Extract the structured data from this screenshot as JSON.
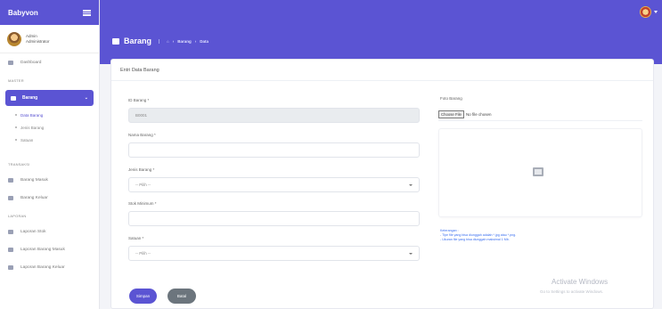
{
  "app": {
    "name": "Babyvon"
  },
  "user": {
    "name": "Admin",
    "role": "Administrator"
  },
  "sidebar": {
    "dashboard": "Dashboard",
    "master_heading": "MASTER",
    "master_item": "Barang",
    "sub_items": [
      "Data Barang",
      "Jenis Barang",
      "Satuan"
    ],
    "transaksi_heading": "TRANSAKSI",
    "transaksi_items": [
      "Barang Masuk",
      "Barang Keluar"
    ],
    "laporan_heading": "LAPORAN",
    "laporan_items": [
      "Laporan Stok",
      "Laporan Barang Masuk",
      "Laporan Barang Keluar"
    ]
  },
  "header": {
    "title": "Barang",
    "breadcrumb": [
      "Barang",
      "Data"
    ]
  },
  "form": {
    "title": "Entri Data Barang",
    "id_label": "ID Barang *",
    "id_value": "B0001",
    "name_label": "Nama Barang *",
    "jenis_label": "Jenis Barang *",
    "jenis_selected": "-- Pilih --",
    "stok_label": "Stok Minimum *",
    "satuan_label": "Satuan *",
    "satuan_selected": "-- Pilih --",
    "photo_label": "Foto Barang",
    "choose_file": "Choose File",
    "no_file": "No file chosen",
    "note_heading": "Keterangan :",
    "note_lines": [
      "- Tipe file yang bisa diunggah adalah *.jpg atau *.png.",
      "- Ukuran file yang bisa diunggah maksimal 1 Mb."
    ],
    "save_label": "Simpan",
    "reset_label": "Batal"
  },
  "watermark": {
    "title": "Activate Windows",
    "subtitle": "Go to Settings to activate Windows."
  }
}
